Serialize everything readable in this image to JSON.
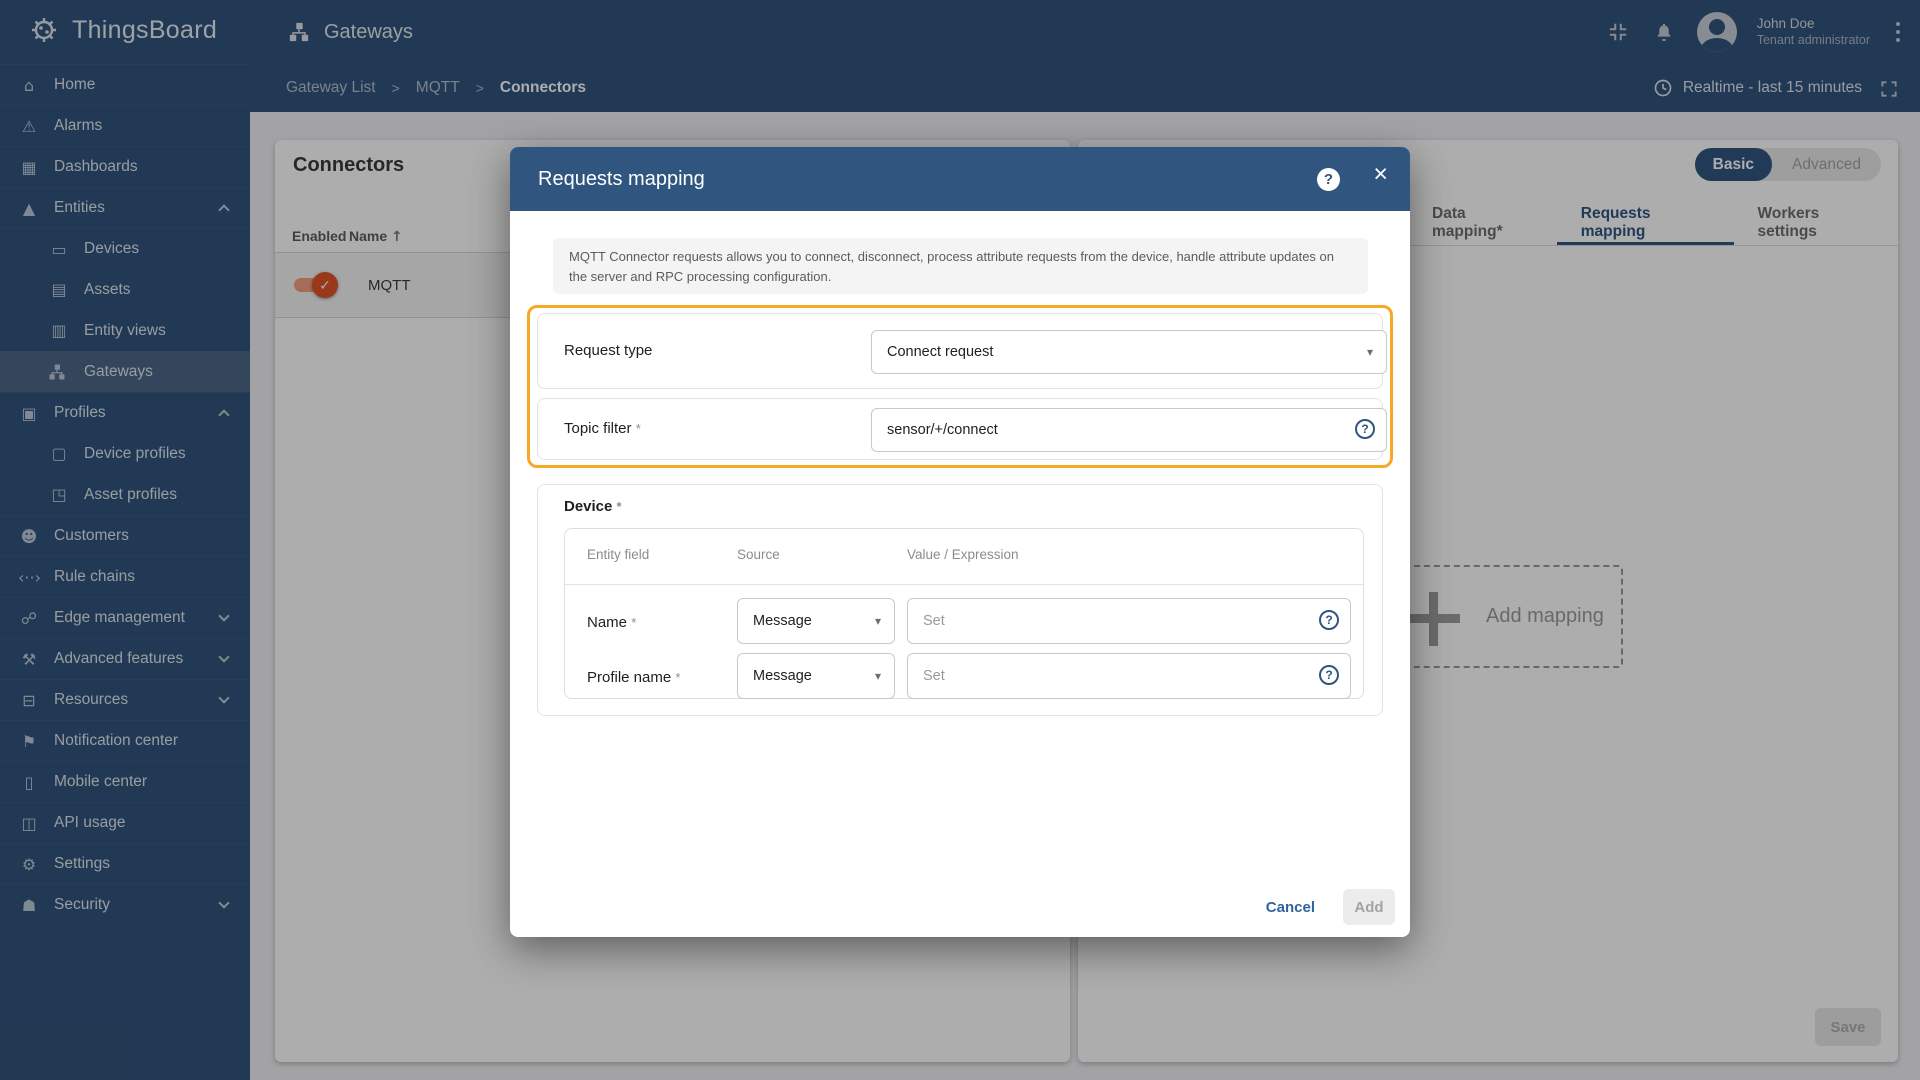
{
  "app": {
    "brand": "ThingsBoard",
    "page_title": "Gateways",
    "user": {
      "name": "John Doe",
      "role": "Tenant administrator"
    },
    "time_window": "Realtime - last 15 minutes"
  },
  "breadcrumb": {
    "items": [
      "Gateway List",
      "MQTT",
      "Connectors"
    ],
    "separator": ">"
  },
  "icons": {
    "home": "⌂",
    "alarms": "⚠",
    "dashboards": "▦",
    "entities": "▲",
    "devices": "▭",
    "assets": "▤",
    "entity_views": "▥",
    "profiles": "▣",
    "device_profiles": "▢",
    "asset_profiles": "◳",
    "customers": "☻",
    "rule_chains": "‹··›",
    "edge": "☍",
    "advanced": "⚒",
    "resources": "⊟",
    "notification": "⚑",
    "mobile": "▯",
    "api": "◫",
    "settings": "⚙",
    "security": "☗"
  },
  "sidebar": {
    "items": [
      {
        "label": "Home",
        "icon": "home",
        "divider": true
      },
      {
        "label": "Alarms",
        "icon": "alarms",
        "divider": true
      },
      {
        "label": "Dashboards",
        "icon": "dashboards",
        "divider": true
      },
      {
        "label": "Entities",
        "icon": "entities",
        "divider": true,
        "chevron": "up"
      },
      {
        "label": "Devices",
        "icon": "devices",
        "divider": true,
        "indent": true
      },
      {
        "label": "Assets",
        "icon": "assets",
        "indent": true
      },
      {
        "label": "Entity views",
        "icon": "entity_views",
        "indent": true
      },
      {
        "label": "Gateways",
        "icon": "gateways",
        "indent": true,
        "active": true
      },
      {
        "label": "Profiles",
        "icon": "profiles",
        "divider": true,
        "chevron": "up"
      },
      {
        "label": "Device profiles",
        "icon": "device_profiles",
        "indent": true
      },
      {
        "label": "Asset profiles",
        "icon": "asset_profiles",
        "indent": true
      },
      {
        "label": "Customers",
        "icon": "customers",
        "divider": true
      },
      {
        "label": "Rule chains",
        "icon": "rule_chains",
        "divider": true
      },
      {
        "label": "Edge management",
        "icon": "edge",
        "divider": true,
        "chevron": "down"
      },
      {
        "label": "Advanced features",
        "icon": "advanced",
        "divider": true,
        "chevron": "down"
      },
      {
        "label": "Resources",
        "icon": "resources",
        "divider": true,
        "chevron": "down"
      },
      {
        "label": "Notification center",
        "icon": "notification",
        "divider": true
      },
      {
        "label": "Mobile center",
        "icon": "mobile",
        "divider": true
      },
      {
        "label": "API usage",
        "icon": "api",
        "divider": true
      },
      {
        "label": "Settings",
        "icon": "settings",
        "divider": true
      },
      {
        "label": "Security",
        "icon": "security",
        "divider": true,
        "chevron": "down"
      }
    ]
  },
  "connectors_panel": {
    "title": "Connectors",
    "columns": {
      "enabled": "Enabled",
      "name": "Name",
      "sort_arrow": "↑"
    },
    "rows": [
      {
        "name": "MQTT",
        "enabled": true
      }
    ]
  },
  "config_panel": {
    "mode_toggle": {
      "active": "Basic",
      "inactive": "Advanced"
    },
    "tabs": [
      {
        "label": "Data mapping*"
      },
      {
        "label": "Requests mapping",
        "active": true
      },
      {
        "label": "Workers settings"
      }
    ],
    "add_mapping_label": "Add mapping",
    "save_label": "Save"
  },
  "modal": {
    "title": "Requests mapping",
    "close_glyph": "×",
    "help_glyph": "?",
    "description": "MQTT Connector requests allows you to connect, disconnect, process attribute requests from the device, handle attribute updates on the server and RPC processing configuration.",
    "request_type": {
      "label": "Request type",
      "value": "Connect request",
      "arrow": "▾"
    },
    "topic_filter": {
      "label": "Topic filter",
      "required_mark": "*",
      "value": "sensor/+/connect"
    },
    "device": {
      "label": "Device",
      "required_mark": "*",
      "columns": [
        "Entity field",
        "Source",
        "Value / Expression"
      ],
      "rows": [
        {
          "field": "Name",
          "required_mark": "*",
          "source": "Message",
          "value_placeholder": "Set"
        },
        {
          "field": "Profile name",
          "required_mark": "*",
          "source": "Message",
          "value_placeholder": "Set"
        }
      ]
    },
    "footer": {
      "cancel_label": "Cancel",
      "add_label": "Add"
    }
  },
  "colors": {
    "primary": "#305680",
    "topbar": "#32547c",
    "highlight_border": "#f9a825",
    "toggle_on": "#e25426",
    "cancel_text": "#2e64a0"
  }
}
